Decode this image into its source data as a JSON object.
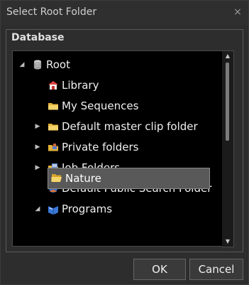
{
  "window": {
    "title": "Select Root Folder",
    "close_glyph": "×"
  },
  "group": {
    "label": "Database"
  },
  "tree": {
    "items": [
      {
        "label": "Root",
        "icon": "database-icon",
        "expanded": true,
        "indent": 0
      },
      {
        "label": "Library",
        "icon": "library-icon",
        "indent": 1
      },
      {
        "label": "My Sequences",
        "icon": "folder-icon",
        "indent": 1
      },
      {
        "label": "Default master clip folder",
        "icon": "folder-icon",
        "has_children": true,
        "indent": 1
      },
      {
        "label": "Private folders",
        "icon": "private-folder-icon",
        "has_children": true,
        "indent": 1
      },
      {
        "label": "Job Folders",
        "icon": "job-folder-icon",
        "has_children": true,
        "indent": 1
      },
      {
        "label": "Default Public Search Folder",
        "icon": "search-folder-icon",
        "indent": 1
      },
      {
        "label": "Programs",
        "icon": "programs-icon",
        "expanded": true,
        "indent": 1
      },
      {
        "label": "Nature",
        "icon": "open-folder-icon",
        "selected": true,
        "indent": 2
      }
    ]
  },
  "buttons": {
    "ok": "OK",
    "cancel": "Cancel"
  },
  "colors": {
    "selection": "#595959",
    "tree_bg": "#000000",
    "window_bg": "#2d2d2d"
  }
}
